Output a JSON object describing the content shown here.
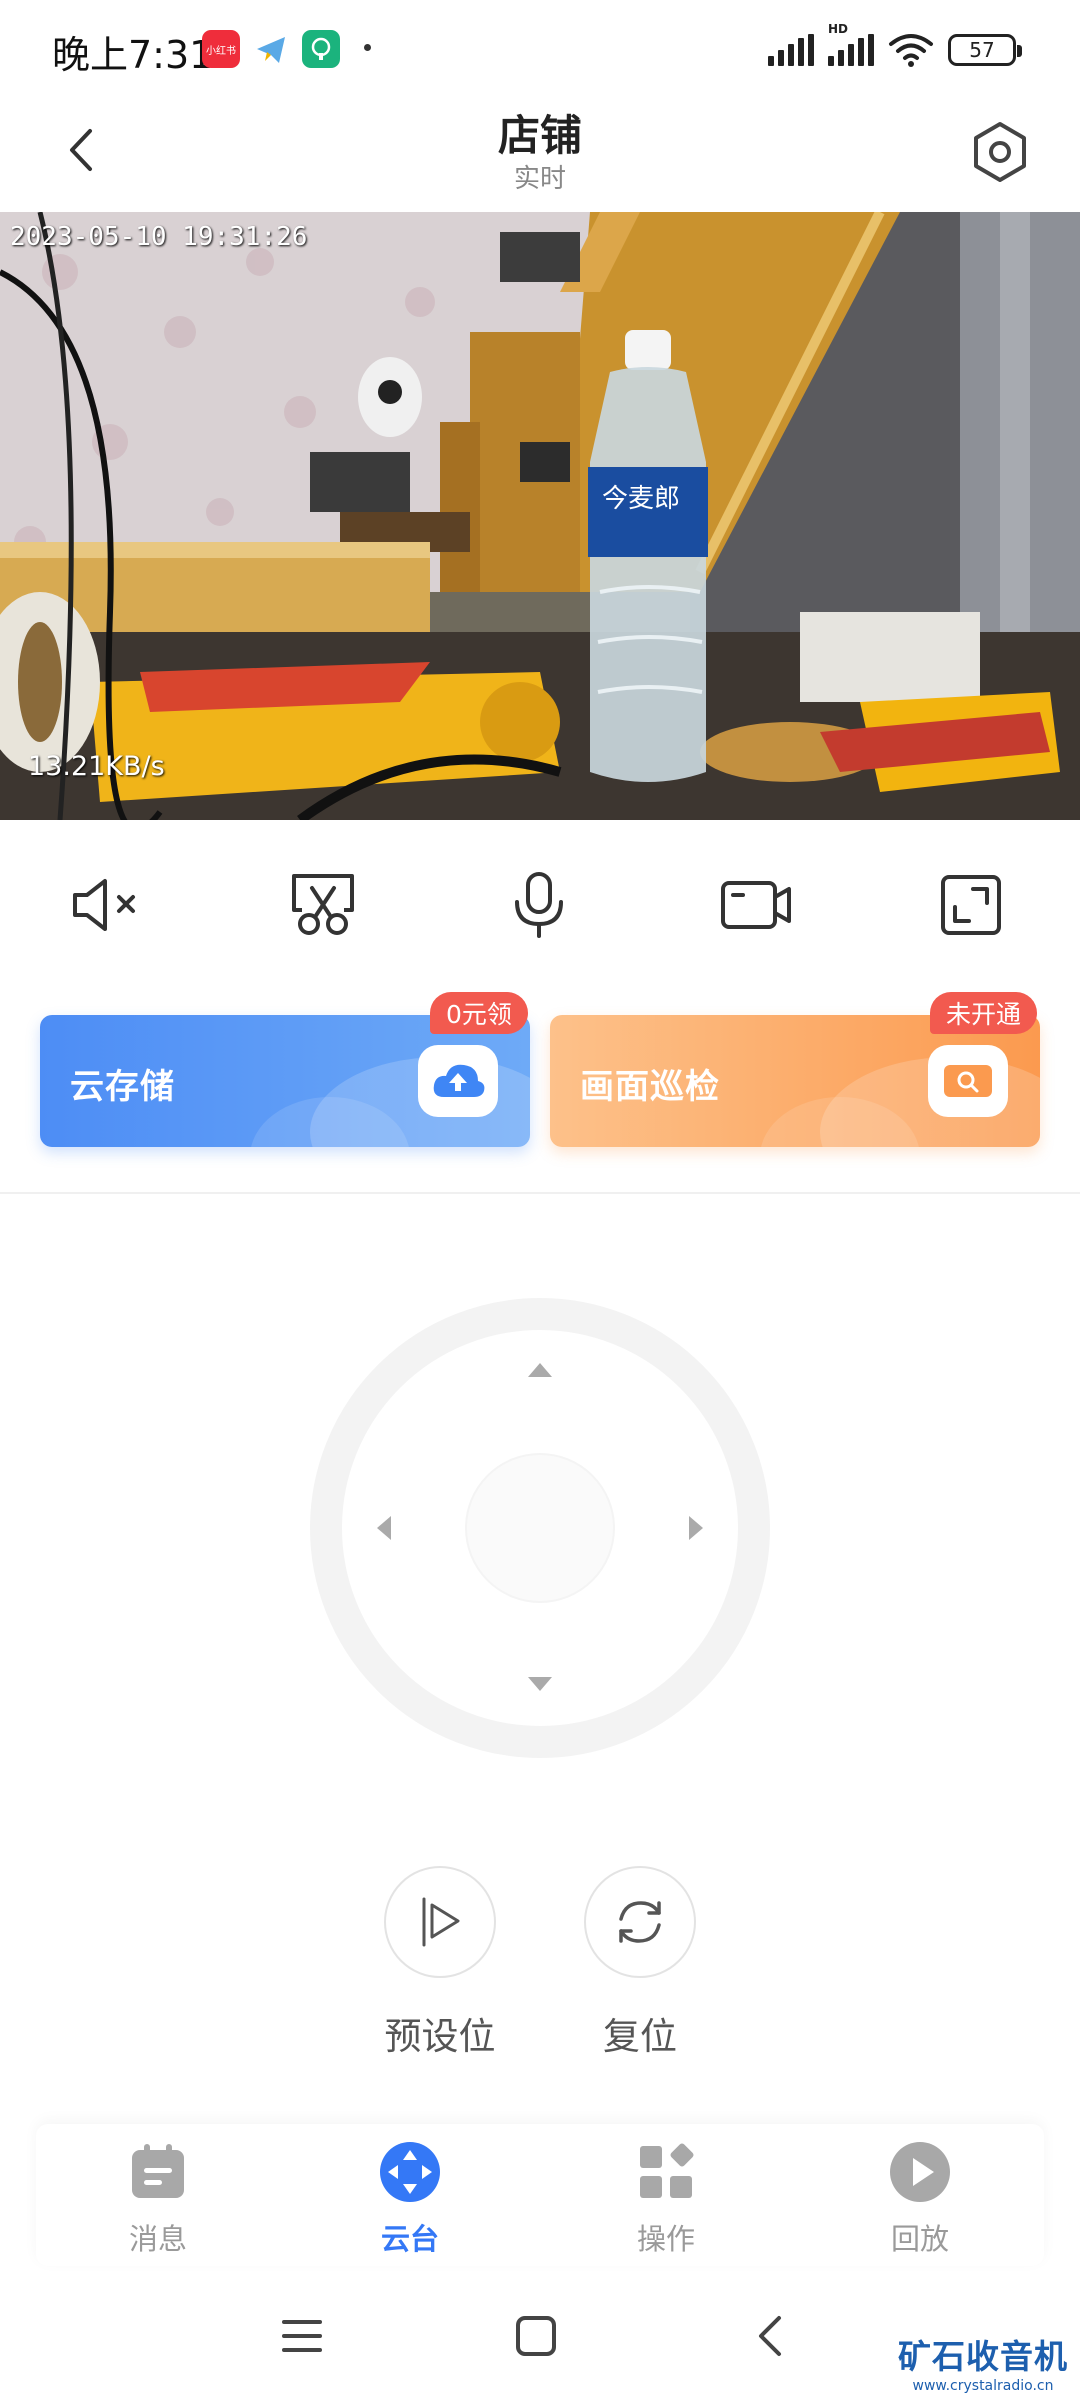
{
  "status_bar": {
    "time": "晚上7:31",
    "app_icons": [
      {
        "name": "xiaohongshu-icon",
        "label": "小红书",
        "color": "#ef2d3b"
      },
      {
        "name": "telegram-like-icon",
        "label": "",
        "color": "#5aa9e6"
      },
      {
        "name": "green-app-icon",
        "label": "",
        "color": "#1bb37d"
      }
    ],
    "network_label": "HD",
    "battery": "57"
  },
  "header": {
    "title": "店铺",
    "subtitle": "实时"
  },
  "video": {
    "timestamp": "2023-05-10 19:31:26",
    "bitrate": "13.21KB/s"
  },
  "controls": [
    {
      "name": "mute-icon"
    },
    {
      "name": "screenshot-scissors-icon"
    },
    {
      "name": "microphone-icon"
    },
    {
      "name": "record-video-icon"
    },
    {
      "name": "fullscreen-icon"
    }
  ],
  "cards": {
    "cloud_storage": {
      "label": "云存储",
      "badge": "0元领",
      "icon": "cloud-upload-icon",
      "color": "#4d8df5"
    },
    "patrol": {
      "label": "画面巡检",
      "badge": "未开通",
      "icon": "search-screen-icon",
      "color": "#fb9a4f"
    }
  },
  "ptz": {
    "preset_label": "预设位",
    "reset_label": "复位"
  },
  "tabs": [
    {
      "label": "消息",
      "icon": "message-icon",
      "active": false
    },
    {
      "label": "云台",
      "icon": "ptz-icon",
      "active": true
    },
    {
      "label": "操作",
      "icon": "operation-icon",
      "active": false
    },
    {
      "label": "回放",
      "icon": "playback-icon",
      "active": false
    }
  ],
  "accent_color": "#3478f6",
  "watermark": {
    "main": "矿石收音机",
    "sub": "www.crystalradio.cn"
  }
}
